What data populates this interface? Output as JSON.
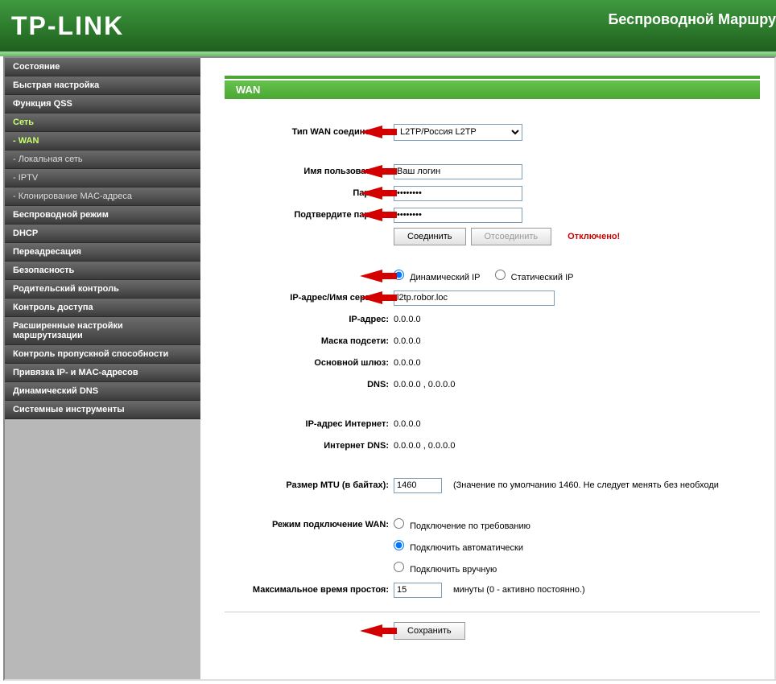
{
  "header": {
    "logo": "TP-LINK",
    "title": "Беспроводной Маршру"
  },
  "sidebar": {
    "items": [
      {
        "label": "Состояние",
        "sub": false,
        "active": false
      },
      {
        "label": "Быстрая настройка",
        "sub": false,
        "active": false
      },
      {
        "label": "Функция QSS",
        "sub": false,
        "active": false
      },
      {
        "label": "Сеть",
        "sub": false,
        "active": true
      },
      {
        "label": "- WAN",
        "sub": true,
        "active": true
      },
      {
        "label": "- Локальная сеть",
        "sub": true,
        "active": false
      },
      {
        "label": "- IPTV",
        "sub": true,
        "active": false
      },
      {
        "label": "- Клонирование MAC-адреса",
        "sub": true,
        "active": false
      },
      {
        "label": "Беспроводной режим",
        "sub": false,
        "active": false
      },
      {
        "label": "DHCP",
        "sub": false,
        "active": false
      },
      {
        "label": "Переадресация",
        "sub": false,
        "active": false
      },
      {
        "label": "Безопасность",
        "sub": false,
        "active": false
      },
      {
        "label": "Родительский контроль",
        "sub": false,
        "active": false
      },
      {
        "label": "Контроль доступа",
        "sub": false,
        "active": false
      },
      {
        "label": "Расширенные настройки маршрутизации",
        "sub": false,
        "active": false
      },
      {
        "label": "Контроль пропускной способности",
        "sub": false,
        "active": false
      },
      {
        "label": "Привязка IP- и MAC-адресов",
        "sub": false,
        "active": false
      },
      {
        "label": "Динамический DNS",
        "sub": false,
        "active": false
      },
      {
        "label": "Системные инструменты",
        "sub": false,
        "active": false
      }
    ]
  },
  "panel": {
    "title": "WAN",
    "labels": {
      "wan_type": "Тип WAN соединения:",
      "username": "Имя пользователя:",
      "password": "Пароль:",
      "confirm": "Подтвердите пароль:",
      "server": "IP-адрес/Имя сервера:",
      "ip": "IP-адрес:",
      "mask": "Маска подсети:",
      "gw": "Основной шлюз:",
      "dns": "DNS:",
      "inet_ip": "IP-адрес Интернет:",
      "inet_dns": "Интернет DNS:",
      "mtu": "Размер MTU (в байтах):",
      "wan_mode": "Режим подключение WAN:",
      "idle": "Максимальное время простоя:"
    },
    "values": {
      "wan_type": "L2TP/Россия L2TP",
      "username": "Ваш логин",
      "password": "●●●●●●●●",
      "confirm": "●●●●●●●●",
      "server": "l2tp.robor.loc",
      "ip": "0.0.0.0",
      "mask": "0.0.0.0",
      "gw": "0.0.0.0",
      "dns": "0.0.0.0 , 0.0.0.0",
      "inet_ip": "0.0.0.0",
      "inet_dns": "0.0.0.0 , 0.0.0.0",
      "mtu": "1460",
      "idle": "15"
    },
    "buttons": {
      "connect": "Соединить",
      "disconnect": "Отсоединить",
      "save": "Сохранить"
    },
    "status": "Отключено!",
    "ip_mode": {
      "dynamic": "Динамический IP",
      "static": "Статический IP"
    },
    "mtu_hint": "(Значение по умолчанию 1460. Не следует менять без необходи",
    "wan_modes": {
      "demand": "Подключение по требованию",
      "auto": "Подключить автоматически",
      "manual": "Подключить вручную"
    },
    "idle_hint": "минуты (0 - активно постоянно.)"
  }
}
